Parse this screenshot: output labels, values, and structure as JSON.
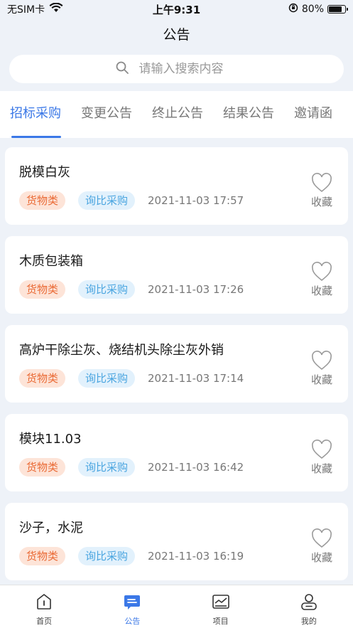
{
  "status_bar": {
    "carrier": "无SIM卡",
    "time": "上午9:31",
    "battery": "80%",
    "battery_level": 0.8,
    "icons": [
      "wifi-icon",
      "orientation-lock-icon",
      "battery-icon"
    ]
  },
  "header": {
    "title": "公告"
  },
  "search": {
    "placeholder": "请输入搜索内容",
    "value": ""
  },
  "tabs": [
    {
      "label": "招标采购",
      "active": true
    },
    {
      "label": "变更公告",
      "active": false
    },
    {
      "label": "终止公告",
      "active": false
    },
    {
      "label": "结果公告",
      "active": false
    },
    {
      "label": "邀请函",
      "active": false
    }
  ],
  "announcements": [
    {
      "title": "脱模白灰",
      "category": "货物类",
      "method": "询比采购",
      "date": "2021-11-03 17:57",
      "fav_label": "收藏"
    },
    {
      "title": "木质包装箱",
      "category": "货物类",
      "method": "询比采购",
      "date": "2021-11-03 17:26",
      "fav_label": "收藏"
    },
    {
      "title": "高炉干除尘灰、烧结机头除尘灰外销",
      "category": "货物类",
      "method": "询比采购",
      "date": "2021-11-03 17:14",
      "fav_label": "收藏"
    },
    {
      "title": "模块11.03",
      "category": "货物类",
      "method": "询比采购",
      "date": "2021-11-03 16:42",
      "fav_label": "收藏"
    },
    {
      "title": "沙子，水泥",
      "category": "货物类",
      "method": "询比采购",
      "date": "2021-11-03 16:19",
      "fav_label": "收藏"
    }
  ],
  "tabbar": [
    {
      "label": "首页",
      "icon": "home-icon",
      "active": false
    },
    {
      "label": "公告",
      "icon": "announcement-icon",
      "active": true
    },
    {
      "label": "项目",
      "icon": "project-icon",
      "active": false
    },
    {
      "label": "我的",
      "icon": "profile-icon",
      "active": false
    }
  ],
  "colors": {
    "accent": "#3b78e7",
    "page_background": "#eef2f8",
    "tag_goods_bg": "#fde4d8",
    "tag_goods_text": "#ea6a35",
    "tag_method_bg": "#e2f1fc",
    "tag_method_text": "#4aa5e0"
  }
}
